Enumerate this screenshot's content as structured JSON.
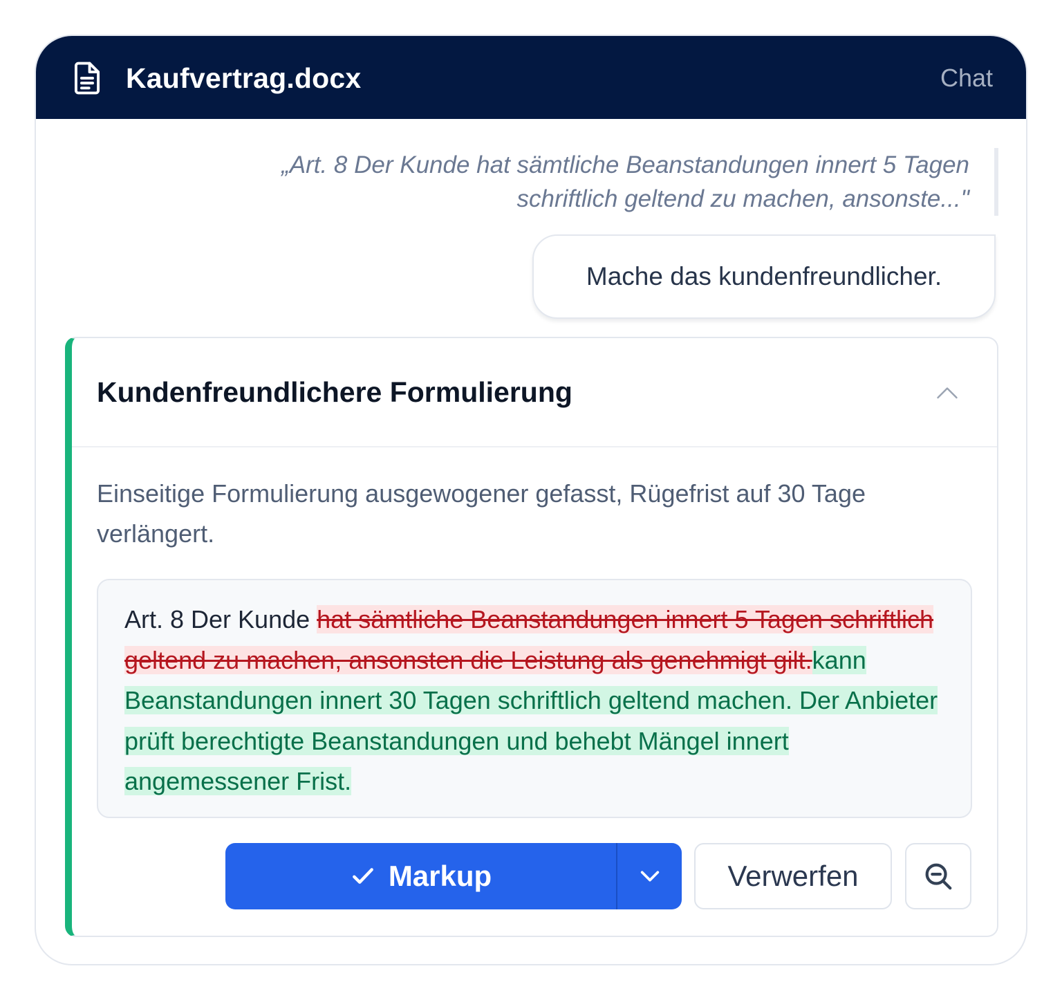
{
  "header": {
    "document_icon": "document-icon",
    "title": "Kaufvertrag.docx",
    "chat_label": "Chat"
  },
  "quote": {
    "text": "„Art. 8 Der Kunde hat sämtliche Beanstandungen innert 5 Tagen schriftlich geltend zu machen, ansonste...\""
  },
  "user_message": {
    "text": "Mache das kundenfreundlicher."
  },
  "suggestion": {
    "accent_color": "#19b47c",
    "title": "Kundenfreundlichere Formulierung",
    "collapse_icon": "chevron-up-icon",
    "description": "Einseitige Formulierung ausgewogener gefasst, Rügefrist auf 30 Tage verlängert.",
    "diff": {
      "unchanged": "Art. 8 Der Kunde ",
      "deleted": "hat sämtliche Beanstandungen innert 5 Tagen schriftlich geltend zu machen, ansonsten die Leistung als genehmigt gilt.",
      "inserted": "kann Beanstandungen innert 30 Tagen schriftlich geltend machen. Der Anbieter prüft berechtigte Beanstandungen und behebt Mängel innert angemessener Frist."
    },
    "actions": {
      "accept_label": "Markup",
      "accept_icon": "check-icon",
      "dropdown_icon": "chevron-down-icon",
      "discard_label": "Verwerfen",
      "inspect_icon": "zoom-out-icon"
    }
  },
  "colors": {
    "header_bg": "#031841",
    "primary": "#2563eb",
    "deleted_bg": "#fde3e3",
    "deleted_text": "#b5161f",
    "inserted_bg": "#d2f6e4",
    "inserted_text": "#08704a"
  }
}
